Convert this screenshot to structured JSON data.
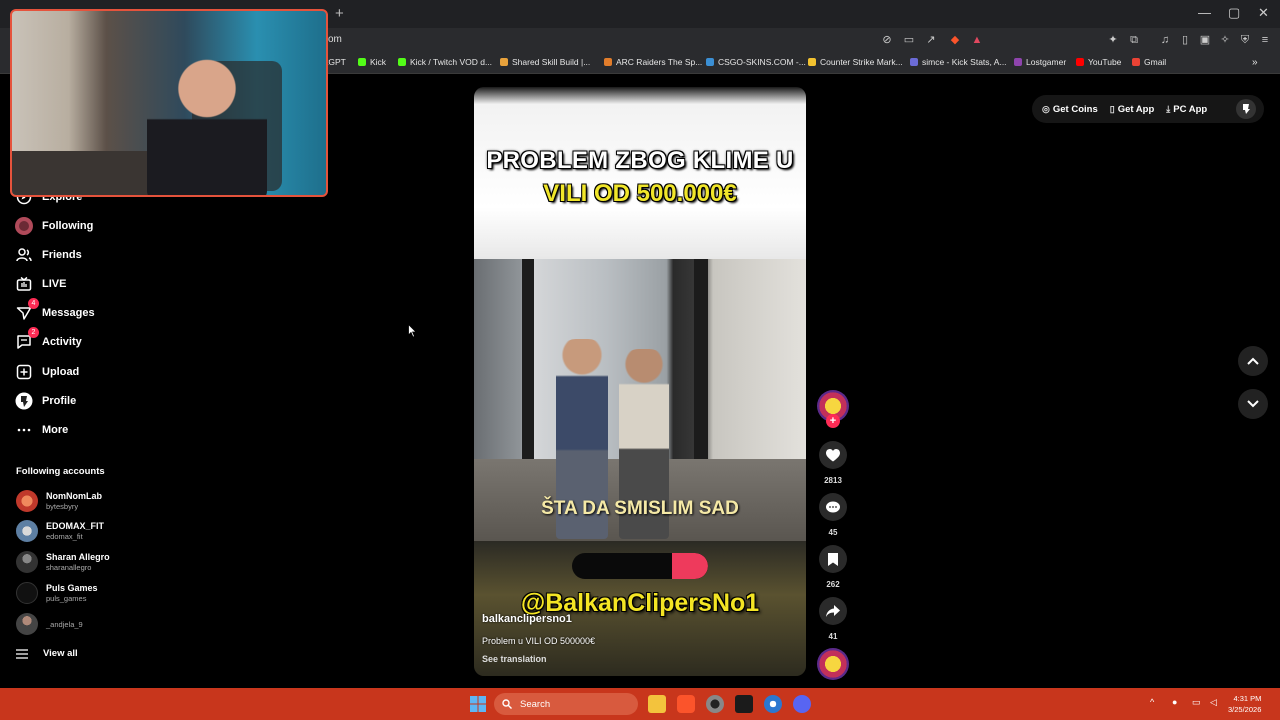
{
  "browser": {
    "url_fragment": "om",
    "new_tab": "+",
    "window_controls": [
      "—",
      "▢",
      "✕"
    ],
    "bookmarks": [
      {
        "label": "tGPT",
        "color": "#10a37f"
      },
      {
        "label": "Kick",
        "color": "#53fc18"
      },
      {
        "label": "Kick / Twitch VOD d...",
        "color": "#53fc18"
      },
      {
        "label": "Shared Skill Build |...",
        "color": "#e8a23c"
      },
      {
        "label": "ARC Raiders The Sp...",
        "color": "#e27d2b"
      },
      {
        "label": "CSGO-SKINS.COM -...",
        "color": "#3b8fd4"
      },
      {
        "label": "Counter Strike Mark...",
        "color": "#f2c230"
      },
      {
        "label": "simce - Kick Stats, A...",
        "color": "#6b6bd6"
      },
      {
        "label": "Lostgamer",
        "color": "#8e44ad"
      },
      {
        "label": "YouTube",
        "color": "#ff0000"
      },
      {
        "label": "Gmail",
        "color": "#ea4335"
      }
    ]
  },
  "sidebar": {
    "nav": [
      {
        "label": "Explore",
        "icon": "compass-icon"
      },
      {
        "label": "Following",
        "icon": "following-avatar-icon"
      },
      {
        "label": "Friends",
        "icon": "friends-icon"
      },
      {
        "label": "LIVE",
        "icon": "live-icon"
      },
      {
        "label": "Messages",
        "icon": "messages-icon",
        "badge": "4"
      },
      {
        "label": "Activity",
        "icon": "activity-icon",
        "badge": "2"
      },
      {
        "label": "Upload",
        "icon": "upload-icon"
      },
      {
        "label": "Profile",
        "icon": "profile-icon"
      },
      {
        "label": "More",
        "icon": "more-icon"
      }
    ],
    "following_title": "Following accounts",
    "accounts": [
      {
        "name": "NomNomLab",
        "user": "bytesbyry",
        "color": "#c0392b"
      },
      {
        "name": "EDOMAX_FIT",
        "user": "edomax_fit",
        "color": "#5d7fa3"
      },
      {
        "name": "Sharan Allegro",
        "user": "sharanallegro",
        "color": "#444"
      },
      {
        "name": "Puls Games",
        "user": "puls_games",
        "color": "#222"
      },
      {
        "name": "",
        "user": "_andjela_9",
        "color": "#555"
      }
    ],
    "view_all": "View all"
  },
  "topright": {
    "coins": "Get Coins",
    "app": "Get App",
    "pc": "PC App"
  },
  "video": {
    "title_line1": "PROBLEM ZBOG KLIME U",
    "title_line2": "VILI OD 500.000€",
    "caption": "ŠTA DA SMISLIM SAD",
    "handle_overlay": "@BalkanClipersNo1",
    "author": "balkanclipersno1",
    "description": "Problem u VILI OD 500000€",
    "see_translation": "See translation"
  },
  "actions": {
    "likes": "2813",
    "comments": "45",
    "saves": "262",
    "shares": "41",
    "plus": "+"
  },
  "taskbar": {
    "search": "Search",
    "time": "4:31 PM",
    "date": "3/25/2026"
  }
}
